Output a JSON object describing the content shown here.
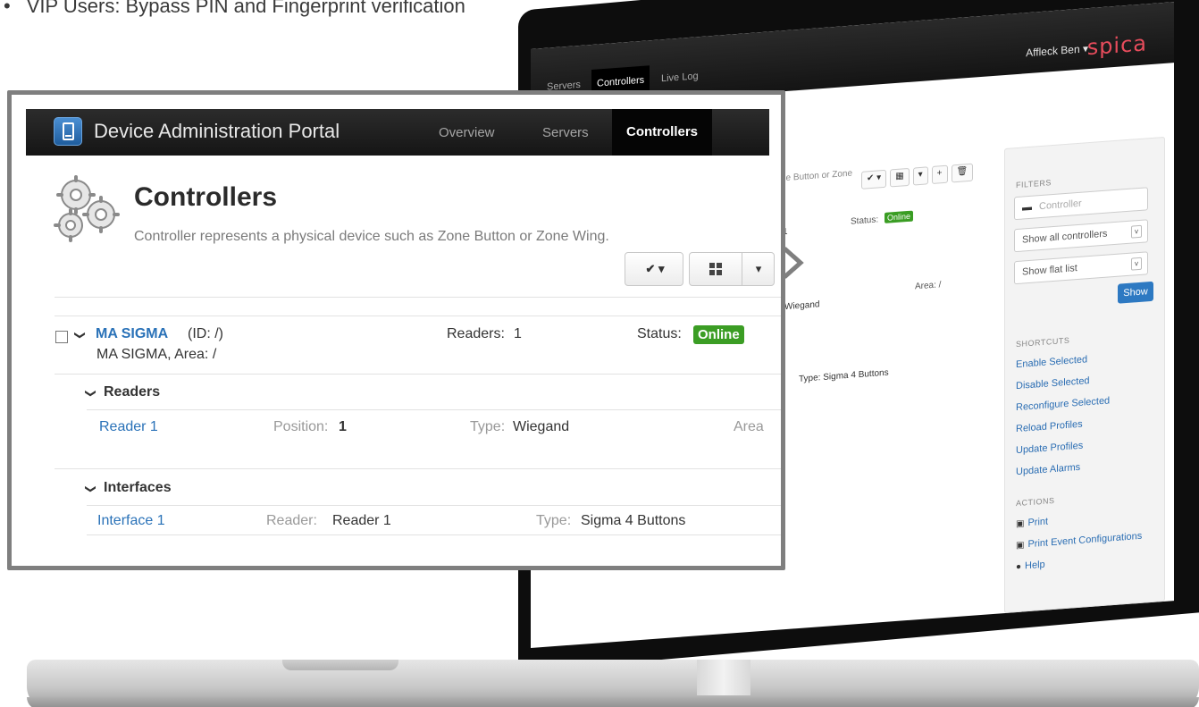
{
  "caption": {
    "bullet": "•",
    "text": "VIP Users: Bypass PIN and Fingerprint verification"
  },
  "app": {
    "title": "Device Administration Portal",
    "tabs": [
      {
        "label": "Overview",
        "active": false
      },
      {
        "label": "Servers",
        "active": false
      },
      {
        "label": "Controllers",
        "active": true
      }
    ]
  },
  "page": {
    "title": "Controllers",
    "description": "Controller represents a physical device such as Zone Button or Zone Wing."
  },
  "toolbar": {
    "check_icon": "✔",
    "caret": "▾",
    "grid_icon": "grid-icon"
  },
  "controller": {
    "name": "MA SIGMA",
    "id_text": "(ID: /)",
    "subtitle": "MA SIGMA, Area: /",
    "readers_label": "Readers:",
    "readers_value": "1",
    "status_label": "Status:",
    "status_value": "Online",
    "status_color": "#3b9d24"
  },
  "readers": {
    "heading": "Readers",
    "items": [
      {
        "name": "Reader 1",
        "position_label": "Position:",
        "position_value": "1",
        "type_label": "Type:",
        "type_value": "Wiegand",
        "area_label": "Area"
      }
    ]
  },
  "interfaces": {
    "heading": "Interfaces",
    "items": [
      {
        "name": "Interface 1",
        "reader_label": "Reader:",
        "reader_value": "Reader 1",
        "type_label": "Type:",
        "type_value": "Sigma 4 Buttons"
      }
    ]
  },
  "laptop": {
    "nav": {
      "tabs": [
        "Servers",
        "Controllers",
        "Live Log"
      ],
      "user": "Affleck Ben ▾",
      "logo": "spica"
    },
    "main": {
      "hint": "ne Button or Zone",
      "status_label": "Status:",
      "status_value": "Online",
      "wiegand": "Wiegand",
      "area": "Area: /",
      "type": "Type: Sigma 4 Buttons",
      "row_num": "1"
    },
    "sidebar": {
      "filters_heading": "FILTERS",
      "controller_placeholder": "Controller",
      "select_all": "Show all controllers",
      "select_list": "Show flat list",
      "show_button": "Show",
      "shortcuts_heading": "SHORTCUTS",
      "shortcuts": [
        "Enable Selected",
        "Disable Selected",
        "Reconfigure Selected",
        "Reload Profiles",
        "Update Profiles",
        "Update Alarms"
      ],
      "actions_heading": "ACTIONS",
      "actions": [
        {
          "icon": "print-icon",
          "label": "Print"
        },
        {
          "icon": "print-icon",
          "label": "Print Event Configurations"
        },
        {
          "icon": "help-icon",
          "label": "Help"
        }
      ]
    }
  }
}
